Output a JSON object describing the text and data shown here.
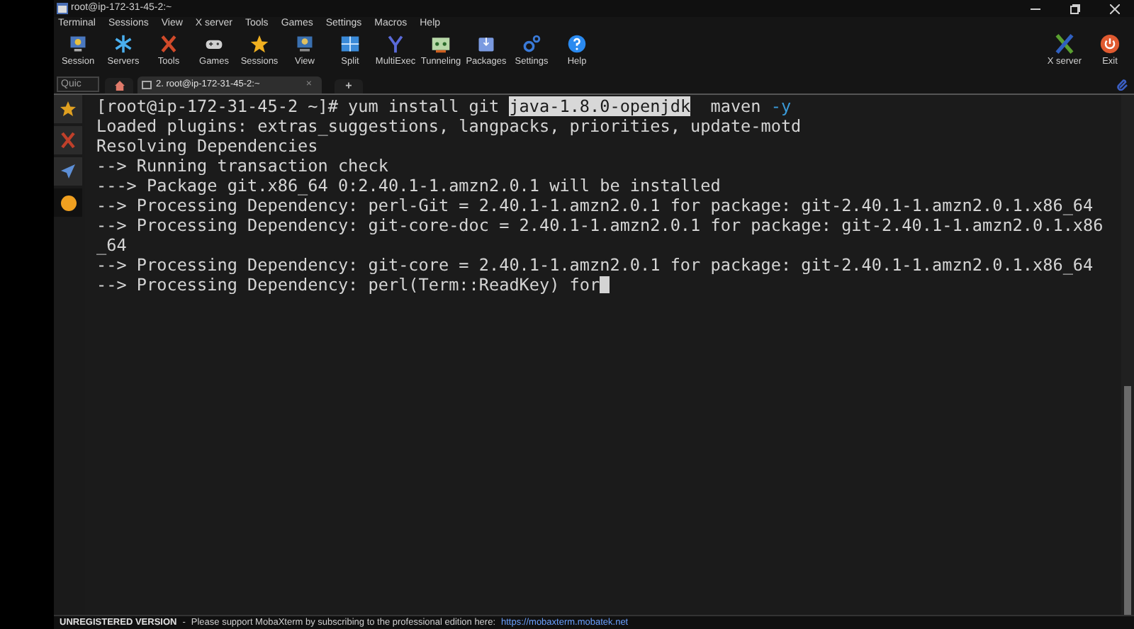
{
  "window": {
    "title": "root@ip-172-31-45-2:~"
  },
  "menu": [
    "Terminal",
    "Sessions",
    "View",
    "X server",
    "Tools",
    "Games",
    "Settings",
    "Macros",
    "Help"
  ],
  "toolbar": [
    "Session",
    "Servers",
    "Tools",
    "Games",
    "Sessions",
    "View",
    "Split",
    "MultiExec",
    "Tunneling",
    "Packages",
    "Settings",
    "Help"
  ],
  "toolbar_right": [
    "X server",
    "Exit"
  ],
  "quick_connect": {
    "placeholder": "Quic"
  },
  "tabs": [
    {
      "kind": "home",
      "selected": false
    },
    {
      "kind": "session",
      "label": "2. root@ip-172-31-45-2:~",
      "close": "×",
      "selected": true
    },
    {
      "kind": "new",
      "label": "+",
      "selected": false
    }
  ],
  "terminal": {
    "lines": [
      {
        "cursor": false,
        "segments": [
          {
            "kind": "plain",
            "text": "[root@ip-172-31-45-2 ~]# yum install git "
          },
          {
            "kind": "highlight",
            "text": "java-1.8.0-openjdk"
          },
          {
            "kind": "plain",
            "text": "  maven "
          },
          {
            "kind": "option",
            "text": "-y"
          }
        ]
      },
      {
        "cursor": false,
        "segments": [
          {
            "kind": "plain",
            "text": "Loaded plugins: extras_suggestions, langpacks, priorities, update-motd"
          }
        ]
      },
      {
        "cursor": false,
        "segments": [
          {
            "kind": "plain",
            "text": "Resolving Dependencies"
          }
        ]
      },
      {
        "cursor": false,
        "segments": [
          {
            "kind": "plain",
            "text": "--> Running transaction check"
          }
        ]
      },
      {
        "cursor": false,
        "segments": [
          {
            "kind": "plain",
            "text": "---> Package git.x86_64 0:2.40.1-1.amzn2.0.1 will be installed"
          }
        ]
      },
      {
        "cursor": false,
        "segments": [
          {
            "kind": "plain",
            "text": "--> Processing Dependency: perl-Git = 2.40.1-1.amzn2.0.1 for package: git-2.40.1-1.amzn2.0.1.x86_64"
          }
        ]
      },
      {
        "cursor": false,
        "segments": [
          {
            "kind": "plain",
            "text": "--> Processing Dependency: git-core-doc = 2.40.1-1.amzn2.0.1 for package: git-2.40.1-1.amzn2.0.1.x86"
          }
        ]
      },
      {
        "cursor": false,
        "segments": [
          {
            "kind": "plain",
            "text": "_64"
          }
        ]
      },
      {
        "cursor": false,
        "segments": [
          {
            "kind": "plain",
            "text": "--> Processing Dependency: git-core = 2.40.1-1.amzn2.0.1 for package: git-2.40.1-1.amzn2.0.1.x86_64"
          }
        ]
      },
      {
        "cursor": true,
        "segments": [
          {
            "kind": "plain",
            "text": "--> Processing Dependency: perl(Term::ReadKey) for"
          }
        ]
      }
    ]
  },
  "status_bar": {
    "label": "UNREGISTERED VERSION",
    "separator": "-",
    "message": "Please support MobaXterm by subscribing to the professional edition here:",
    "link": "https://mobaxterm.mobatek.net"
  }
}
